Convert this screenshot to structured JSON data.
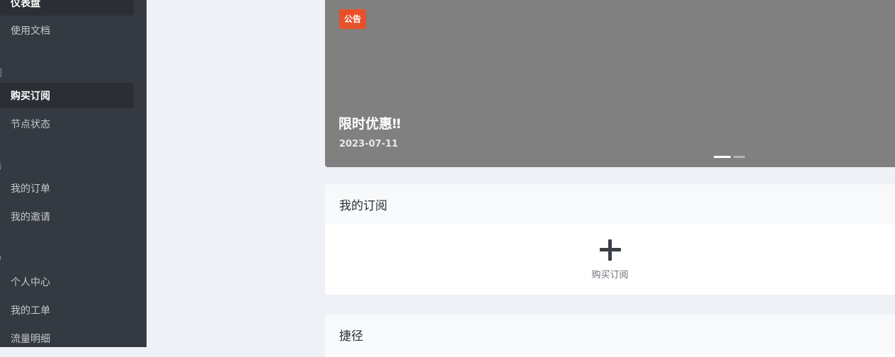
{
  "sidebar": {
    "items": [
      {
        "label": "仪表盘",
        "icon": "dashboard-icon",
        "glyph": "◔",
        "active": true
      },
      {
        "label": "使用文档",
        "icon": "document-icon",
        "glyph": "▯",
        "active": false
      },
      {
        "label": "购买订阅",
        "icon": "shopping-bag-icon",
        "glyph": "▮",
        "active": true
      },
      {
        "label": "节点状态",
        "icon": "node-status-icon",
        "glyph": "◎",
        "active": false
      },
      {
        "label": "我的订单",
        "icon": "order-list-icon",
        "glyph": "≡",
        "active": false
      },
      {
        "label": "我的邀请",
        "icon": "invite-user-icon",
        "glyph": "ሉ",
        "active": false
      },
      {
        "label": "个人中心",
        "icon": "user-icon",
        "glyph": "ᓄ",
        "active": false
      },
      {
        "label": "我的工单",
        "icon": "ticket-icon",
        "glyph": "⊛",
        "active": false
      },
      {
        "label": "流量明细",
        "icon": "traffic-icon",
        "glyph": "▯",
        "active": false
      }
    ],
    "sections": [
      "阅",
      "务",
      "户"
    ]
  },
  "banner": {
    "badge": "公告",
    "title": "限时优惠‼",
    "date": "2023-07-11",
    "slide_count": 2,
    "active_slide": 1
  },
  "subscription_card": {
    "title": "我的订阅",
    "add_label": "购买订阅"
  },
  "shortcut_card": {
    "title": "捷径"
  }
}
